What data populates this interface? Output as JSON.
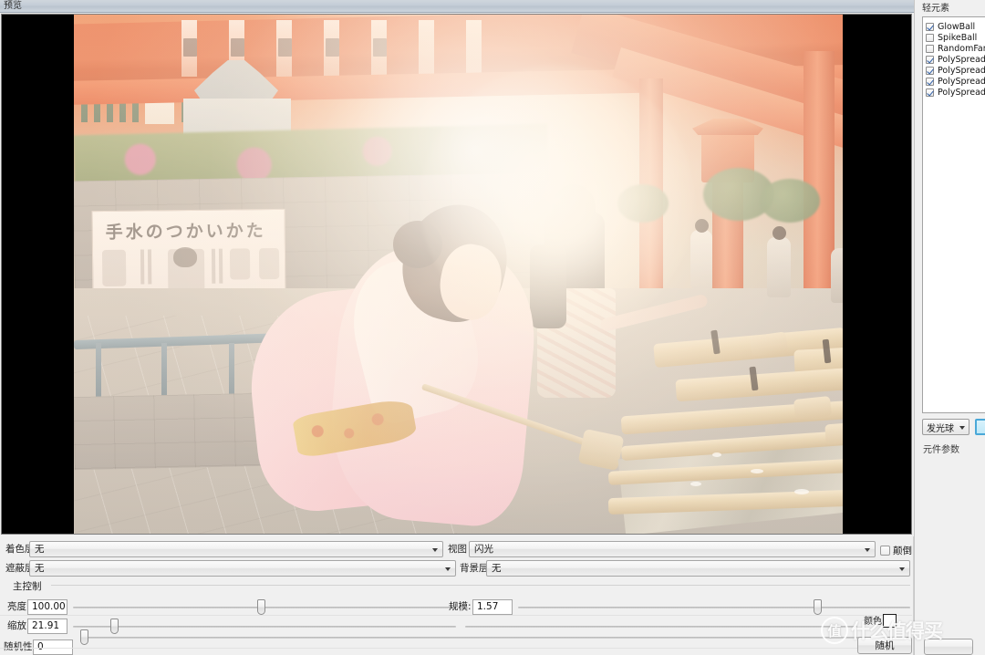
{
  "window": {
    "preview_label": "预览",
    "light_elements_label": "轻元素"
  },
  "preview": {
    "photo_alt": "日本神社手水舍，穿粉色和服的女性用竹柄杓取水，逆光耀斑",
    "sign_title": "手水のつかいかた"
  },
  "element_list": {
    "items": [
      {
        "label": "GlowBall",
        "checked": true
      },
      {
        "label": "SpikeBall",
        "checked": false
      },
      {
        "label": "RandomFan",
        "checked": false
      },
      {
        "label": "PolySpread",
        "checked": true
      },
      {
        "label": "PolySpread",
        "checked": true
      },
      {
        "label": "PolySpread",
        "checked": true
      },
      {
        "label": "PolySpread",
        "checked": true
      }
    ],
    "type_select_value": "发光球",
    "color_swatch": "#bfe8f8",
    "component_params_label": "元件参数"
  },
  "bottom": {
    "shading_layer_label": "着色层",
    "shading_layer_value": "无",
    "mask_layer_label": "遮蔽层",
    "mask_layer_value": "无",
    "view_label": "视图",
    "view_value": "闪光",
    "invert_label": "颠倒",
    "invert_checked": false,
    "background_layer_label": "背景层",
    "background_layer_value": "无",
    "main_control_label": "主控制",
    "brightness_label": "亮度:",
    "brightness_value": "100.00",
    "scale_label": "缩放:",
    "scale_value": "21.91",
    "randomness_label": "随机性:",
    "randomness_value": "0",
    "magnitude_label": "规模:",
    "magnitude_value": "1.57",
    "color_label": "颜色:",
    "color_value": "#ffffff",
    "random_button_label": "随机"
  },
  "watermark": {
    "mark": "值",
    "text": "什么值得买"
  }
}
